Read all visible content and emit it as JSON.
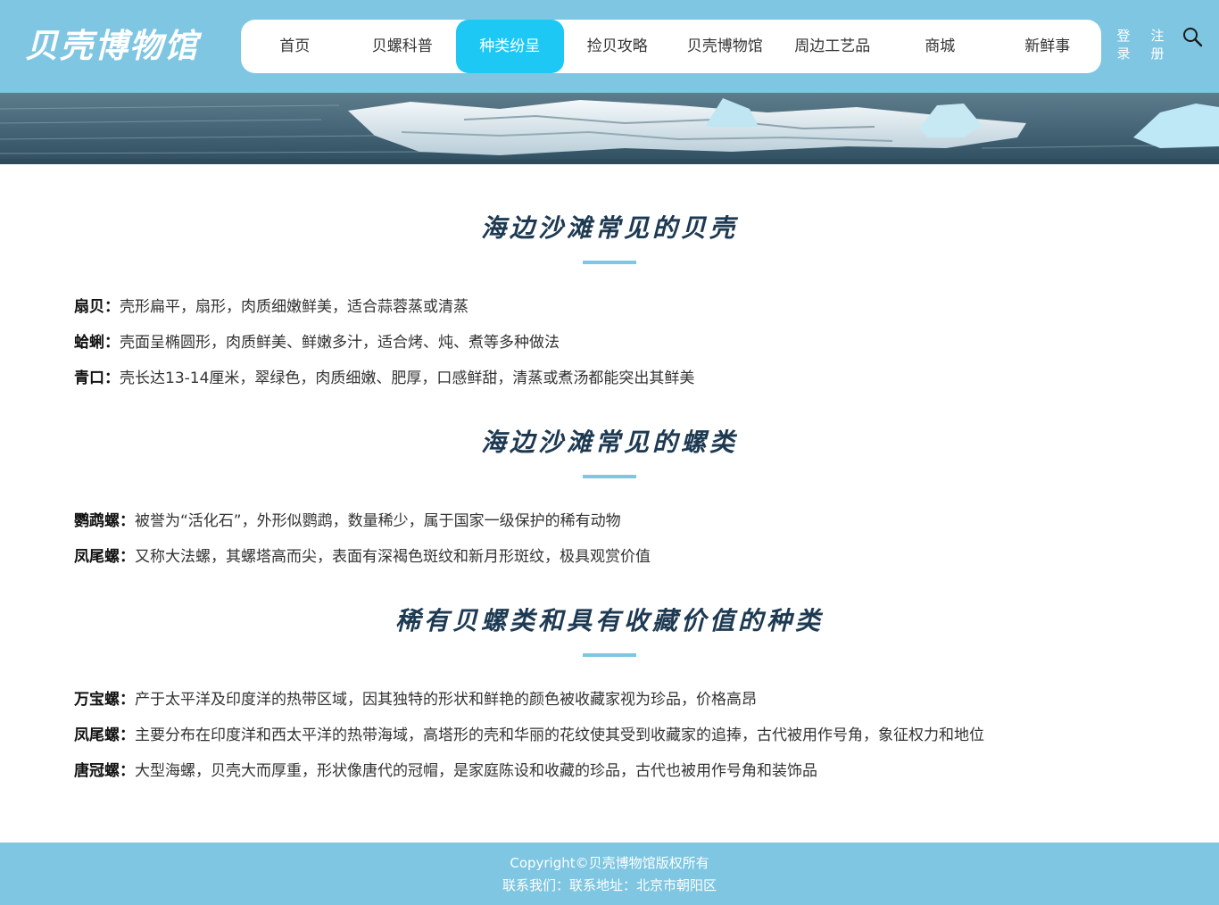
{
  "brand": {
    "logo_text": "贝壳博物馆"
  },
  "nav": {
    "items": [
      {
        "label": "首页"
      },
      {
        "label": "贝螺科普"
      },
      {
        "label": "种类纷呈",
        "active": true
      },
      {
        "label": "捡贝攻略"
      },
      {
        "label": "贝壳博物馆"
      },
      {
        "label": "周边工艺品"
      },
      {
        "label": "商城"
      },
      {
        "label": "新鲜事"
      }
    ],
    "login": "登录",
    "register": "注册",
    "search_icon": "search-icon"
  },
  "colors": {
    "header": "#7ec6e2",
    "active_tab": "#1ec8f4",
    "title": "#1d3a52"
  },
  "sections": [
    {
      "title": "海边沙滩常见的贝壳",
      "items": [
        {
          "name": "扇贝：",
          "desc": "壳形扁平，扇形，肉质细嫩鲜美，适合蒜蓉蒸或清蒸"
        },
        {
          "name": "蛤蜊：",
          "desc": "壳面呈椭圆形，肉质鲜美、鲜嫩多汁，适合烤、炖、煮等多种做法"
        },
        {
          "name": "青口：",
          "desc": "壳长达13-14厘米，翠绿色，肉质细嫩、肥厚，口感鲜甜，清蒸或煮汤都能突出其鲜美"
        }
      ]
    },
    {
      "title": "海边沙滩常见的螺类",
      "items": [
        {
          "name": "鹦鹉螺：",
          "desc": "被誉为“活化石”，外形似鹦鹉，数量稀少，属于国家一级保护的稀有动物"
        },
        {
          "name": "凤尾螺：",
          "desc": "又称大法螺，其螺塔高而尖，表面有深褐色斑纹和新月形斑纹，极具观赏价值"
        }
      ]
    },
    {
      "title": "稀有贝螺类和具有收藏价值的种类",
      "items": [
        {
          "name": "万宝螺：",
          "desc": "产于太平洋及印度洋的热带区域，因其独特的形状和鲜艳的颜色被收藏家视为珍品，价格高昂"
        },
        {
          "name": "凤尾螺：",
          "desc": "主要分布在印度洋和西太平洋的热带海域，高塔形的壳和华丽的花纹使其受到收藏家的追捧，古代被用作号角，象征权力和地位"
        },
        {
          "name": "唐冠螺：",
          "desc": "大型海螺，贝壳大而厚重，形状像唐代的冠帽，是家庭陈设和收藏的珍品，古代也被用作号角和装饰品"
        }
      ]
    }
  ],
  "footer": {
    "copyright": "Copyright©贝壳博物馆版权所有",
    "contact": "联系我们：联系地址：北京市朝阳区"
  }
}
